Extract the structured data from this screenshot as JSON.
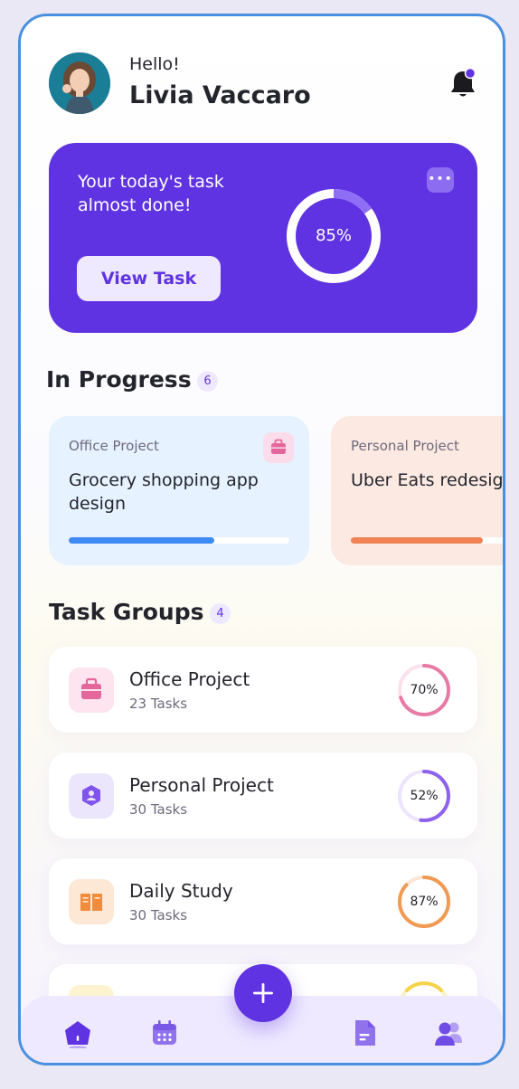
{
  "header": {
    "greeting": "Hello!",
    "user_name": "Livia Vaccaro"
  },
  "hero": {
    "message": "Your today's task almost done!",
    "button_label": "View Task",
    "progress_label": "85%",
    "progress": 0.85
  },
  "in_progress": {
    "title": "In Progress",
    "count": "6",
    "cards": [
      {
        "category": "Office Project",
        "title": "Grocery shopping app design",
        "progress": 0.66,
        "bar_color": "#3d8bf3",
        "bg": "#e6f2ff"
      },
      {
        "category": "Personal Project",
        "title": "Uber Eats redesign challange",
        "progress": 0.6,
        "bar_color": "#ef8355",
        "bg": "#fbe9e2"
      }
    ]
  },
  "task_groups": {
    "title": "Task Groups",
    "count": "4",
    "items": [
      {
        "name": "Office Project",
        "tasks": "23 Tasks",
        "percent_label": "70%",
        "progress": 0.7,
        "color": "#e87aa6",
        "track": "#fbe1ec",
        "icon_bg": "#fde4ee",
        "icon": "briefcase-icon"
      },
      {
        "name": "Personal Project",
        "tasks": "30 Tasks",
        "percent_label": "52%",
        "progress": 0.52,
        "color": "#8d62f0",
        "track": "#ece4fd",
        "icon_bg": "#ece6fd",
        "icon": "user-shield-icon"
      },
      {
        "name": "Daily Study",
        "tasks": "30 Tasks",
        "percent_label": "87%",
        "progress": 0.87,
        "color": "#f09a53",
        "track": "#fde6d3",
        "icon_bg": "#fde7d5",
        "icon": "book-icon"
      }
    ]
  },
  "nav": {
    "items": [
      "home-icon",
      "calendar-icon",
      "document-icon",
      "users-icon"
    ]
  },
  "colors": {
    "primary": "#5f33e1",
    "primary_light": "#eee9ff",
    "text_dark": "#24252c",
    "text_muted": "#6e6a7c"
  }
}
